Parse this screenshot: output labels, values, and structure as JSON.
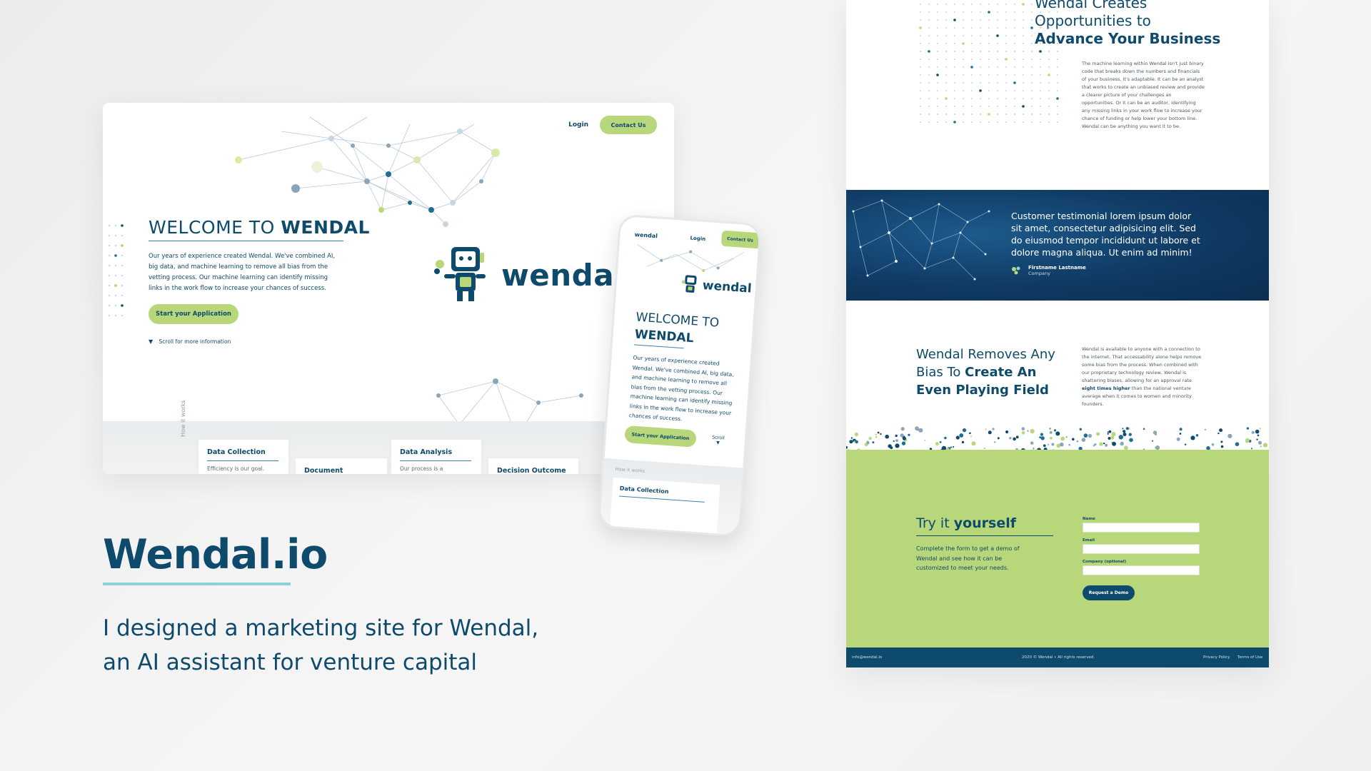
{
  "desktop": {
    "nav": {
      "login": "Login",
      "contact": "Contact Us"
    },
    "welcome_prefix": "WELCOME TO ",
    "welcome_brand": "WENDAL",
    "hero_text": "Our years of experience created Wendal. We've combined AI, big data, and machine learning to remove all bias from the vetting process. Our machine learning can identify missing links in the work flow to increase your chances of success.",
    "cta": "Start your Application",
    "scroll": "Scroll for more information",
    "logo_word": "wendal",
    "how_it_works": "How it works",
    "cards": [
      {
        "title": "Data Collection",
        "desc": "Efficiency is our goal."
      },
      {
        "title": "Document Collection",
        "desc": ""
      },
      {
        "title": "Data Analysis",
        "desc": "Our process is a"
      },
      {
        "title": "Decision Outcome",
        "desc": ""
      }
    ]
  },
  "phone": {
    "logo": "wendal",
    "login": "Login",
    "contact": "Contact Us",
    "brand": "wendal",
    "welcome_1": "WELCOME TO",
    "welcome_2": "WENDAL",
    "text": "Our years of experience created Wendal. We've combined AI, big data, and machine learning to remove all bias from the vetting process. Our machine learning can identify missing links in the work flow to increase your chances of success.",
    "cta": "Start your Application",
    "scroll": "Scroll",
    "how": "How it works",
    "card_title": "Data Collection"
  },
  "title_block": {
    "headline": "Wendal.io",
    "line1": "I designed a marketing site for Wendal,",
    "line2": "an AI assistant for venture capital"
  },
  "longpage": {
    "creates_1": "Wendal Creates",
    "creates_2": "Opportunities to",
    "creates_3": "Advance Your Business",
    "para1": "The machine learning within Wendal isn't just binary code that breaks down the numbers and financials of your business. It's adaptable. It can be an analyst that works to create an unbiased review and provide a clearer picture of your challenges an opportunities.  Or it can be an auditor, identifying any missing links in your work flow to increase your chance of funding or help lower your bottom line. Wendal can be anything you want it to be.",
    "quote": "Customer testimonial lorem ipsum dolor sit amet, consectetur adipisicing elit. Sed do eiusmod tempor incididunt ut labore et dolore magna aliqua. Ut enim ad minim!",
    "author_name": "Firstname Lastname",
    "author_company": "Company",
    "removes_1": "Wendal Removes Any",
    "removes_2": "Bias To ",
    "removes_3": "Create An",
    "removes_4": "Even Playing Field",
    "para2_a": "Wendal is available to anyone with a connection to the internet. That accessability alone helps remove some bias from the process. When combined with our proprietary technology review, Wendal is shattering biases, allowing for an approval rate ",
    "para2_b": "eight times higher",
    "para2_c": " than the national venture average when it comes to women and minority founders.",
    "try_1": "Try it ",
    "try_2": "yourself",
    "try_text": "Complete the form to get a demo of Wendal and see how it can be customized to meet your needs.",
    "form": {
      "name_label": "Name",
      "email_label": "Email",
      "company_label": "Company (optional)",
      "submit": "Request a Demo"
    },
    "footer": {
      "email": "info@wendal.io",
      "copyright": "2020 © Wendal  •  All rights reserved.",
      "privacy": "Privacy Policy",
      "terms": "Terms of Use"
    }
  },
  "colors": {
    "navy": "#0e4a6b",
    "green": "#b7d77a",
    "teal_rule": "#8fcfd6",
    "testimonial_bg": "#0f3a63"
  }
}
